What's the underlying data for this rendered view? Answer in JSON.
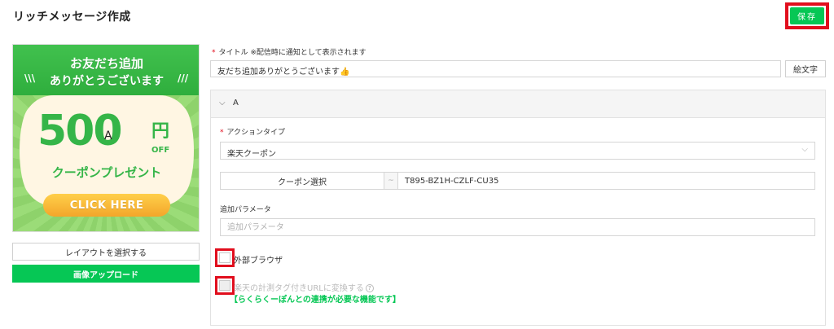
{
  "header": {
    "title": "リッチメッセージ作成",
    "save_label": "保存"
  },
  "banner": {
    "line1": "お友だち追加",
    "line2": "ありがとうございます",
    "amount": "500",
    "yen": "円",
    "off": "OFF",
    "badge": "A",
    "subtitle": "クーポンプレゼント",
    "cta": "CLICK HERE"
  },
  "left_buttons": {
    "layout": "レイアウトを選択する",
    "upload": "画像アップロード"
  },
  "title_field": {
    "required_mark": "*",
    "label": "タイトル ※配信時に通知として表示されます",
    "value": "友だち追加ありがとうございます👍",
    "emoji_button": "絵文字"
  },
  "section": {
    "title": "A",
    "action_type": {
      "required_mark": "*",
      "label": "アクションタイプ",
      "value": "楽天クーポン"
    },
    "coupon": {
      "select_button": "クーポン選択",
      "separator": "~",
      "code": "T895-BZ1H-CZLF-CU35"
    },
    "param": {
      "label": "追加パラメータ",
      "placeholder": "追加パラメータ"
    },
    "checkbox_external": {
      "label": "外部ブラウザ"
    },
    "checkbox_tracking": {
      "label": "楽天の計測タグ付きURLに変換する",
      "help": "?"
    },
    "note": "【らくらくーぽんとの連携が必要な機能です】"
  },
  "colors": {
    "accent": "#06c755",
    "highlight": "#e10e1d"
  }
}
